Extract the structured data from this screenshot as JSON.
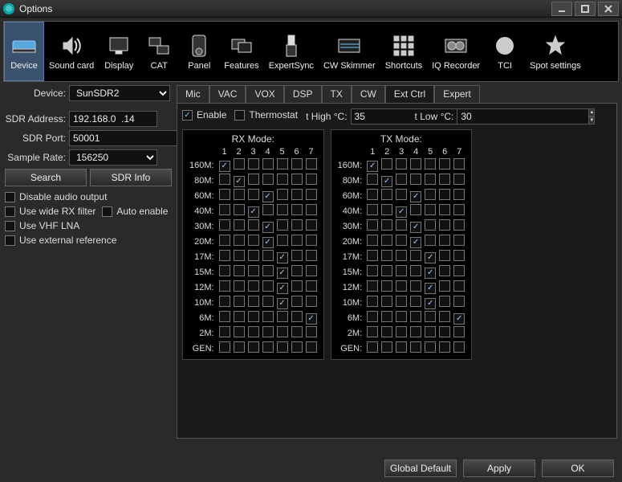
{
  "window": {
    "title": "Options"
  },
  "toolbar": [
    {
      "id": "device",
      "label": "Device",
      "selected": true
    },
    {
      "id": "soundcard",
      "label": "Sound card"
    },
    {
      "id": "display",
      "label": "Display"
    },
    {
      "id": "cat",
      "label": "CAT"
    },
    {
      "id": "panel",
      "label": "Panel"
    },
    {
      "id": "features",
      "label": "Features"
    },
    {
      "id": "expertsync",
      "label": "ExpertSync"
    },
    {
      "id": "cwskimmer",
      "label": "CW Skimmer"
    },
    {
      "id": "shortcuts",
      "label": "Shortcuts"
    },
    {
      "id": "iqrecorder",
      "label": "IQ Recorder"
    },
    {
      "id": "tci",
      "label": "TCI"
    },
    {
      "id": "spotsettings",
      "label": "Spot settings"
    }
  ],
  "left": {
    "device_label": "Device:",
    "device_value": "SunSDR2",
    "sdr_addr_label": "SDR Address:",
    "sdr_addr_value": "192.168.0  .14",
    "sdr_port_label": "SDR Port:",
    "sdr_port_value": "50001",
    "sample_rate_label": "Sample Rate:",
    "sample_rate_value": "156250",
    "search_btn": "Search",
    "sdrinfo_btn": "SDR Info",
    "disable_audio": "Disable audio output",
    "wide_rx": "Use wide RX filter",
    "auto_enable": "Auto enable",
    "vhf_lna": "Use VHF LNA",
    "ext_ref": "Use external reference"
  },
  "subtabs": [
    "Mic",
    "VAC",
    "VOX",
    "DSP",
    "TX",
    "CW",
    "Ext Ctrl",
    "Expert"
  ],
  "subtab_selected": 6,
  "extctrl": {
    "enable_label": "Enable",
    "enable_checked": true,
    "thermostat_label": "Thermostat",
    "thermostat_checked": false,
    "thigh_label": "t High °C:",
    "thigh_value": "35",
    "tlow_label": "t Low °C:",
    "tlow_value": "30",
    "columns": [
      "1",
      "2",
      "3",
      "4",
      "5",
      "6",
      "7"
    ],
    "bands": [
      "160M",
      "80M",
      "60M",
      "40M",
      "30M",
      "20M",
      "17M",
      "15M",
      "12M",
      "10M",
      "6M",
      "2M",
      "GEN"
    ],
    "rx_title": "RX Mode:",
    "tx_title": "TX Mode:",
    "rx": [
      [
        1,
        0,
        0,
        0,
        0,
        0,
        0
      ],
      [
        0,
        1,
        0,
        0,
        0,
        0,
        0
      ],
      [
        0,
        0,
        0,
        1,
        0,
        0,
        0
      ],
      [
        0,
        0,
        1,
        0,
        0,
        0,
        0
      ],
      [
        0,
        0,
        0,
        1,
        0,
        0,
        0
      ],
      [
        0,
        0,
        0,
        1,
        0,
        0,
        0
      ],
      [
        0,
        0,
        0,
        0,
        1,
        0,
        0
      ],
      [
        0,
        0,
        0,
        0,
        1,
        0,
        0
      ],
      [
        0,
        0,
        0,
        0,
        1,
        0,
        0
      ],
      [
        0,
        0,
        0,
        0,
        1,
        0,
        0
      ],
      [
        0,
        0,
        0,
        0,
        0,
        0,
        1
      ],
      [
        0,
        0,
        0,
        0,
        0,
        0,
        0
      ],
      [
        0,
        0,
        0,
        0,
        0,
        0,
        0
      ]
    ],
    "tx": [
      [
        1,
        0,
        0,
        0,
        0,
        0,
        0
      ],
      [
        0,
        1,
        0,
        0,
        0,
        0,
        0
      ],
      [
        0,
        0,
        0,
        1,
        0,
        0,
        0
      ],
      [
        0,
        0,
        1,
        0,
        0,
        0,
        0
      ],
      [
        0,
        0,
        0,
        1,
        0,
        0,
        0
      ],
      [
        0,
        0,
        0,
        1,
        0,
        0,
        0
      ],
      [
        0,
        0,
        0,
        0,
        1,
        0,
        0
      ],
      [
        0,
        0,
        0,
        0,
        1,
        0,
        0
      ],
      [
        0,
        0,
        0,
        0,
        1,
        0,
        0
      ],
      [
        0,
        0,
        0,
        0,
        1,
        0,
        0
      ],
      [
        0,
        0,
        0,
        0,
        0,
        0,
        1
      ],
      [
        0,
        0,
        0,
        0,
        0,
        0,
        0
      ],
      [
        0,
        0,
        0,
        0,
        0,
        0,
        0
      ]
    ]
  },
  "footer": {
    "global_default": "Global Default",
    "apply": "Apply",
    "ok": "OK"
  }
}
